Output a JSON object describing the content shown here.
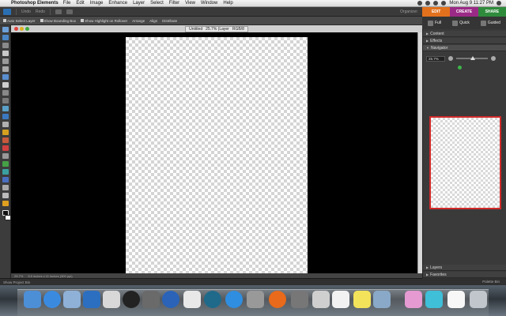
{
  "menubar": {
    "app_name": "Photoshop Elements",
    "items": [
      "File",
      "Edit",
      "Image",
      "Enhance",
      "Layer",
      "Select",
      "Filter",
      "View",
      "Window",
      "Help"
    ],
    "clock": "Mon Aug 9  11:27 PM"
  },
  "topbar": {
    "undo": "Undo",
    "redo": "Redo",
    "organizer": "Organizer"
  },
  "modes": {
    "edit": "EDIT",
    "create": "CREATE",
    "share": "SHARE"
  },
  "edit_tabs": {
    "full": "Full",
    "quick": "Quick",
    "guided": "Guided"
  },
  "options": {
    "auto_select": "Auto Select Layer",
    "bounding_box": "Show Bounding Box",
    "highlight": "Show Highlight on Rollover",
    "arrange": "Arrange",
    "align": "Align",
    "distribute": "Distribute"
  },
  "document": {
    "name": "Untitled",
    "zoom_info": "25.7% (Layer",
    "mode": "RGB/8"
  },
  "status": {
    "zoom": "25.7%",
    "info": "8.5 inches x 11 inches (300 ppi)"
  },
  "bins": {
    "project": "Show Project Bin",
    "palette": "Palette Bin"
  },
  "panels": {
    "content": "Content",
    "effects": "Effects",
    "navigator": "Navigator",
    "layers": "Layers",
    "favorites": "Favorites",
    "zoom_value": "25.7%"
  },
  "colors": {
    "edit": "#e2711d",
    "create": "#9b2a86",
    "share": "#2f8b3c",
    "thumb_border": "#d12a2a"
  },
  "dock_icons": [
    "finder-icon",
    "safari-icon",
    "preview-icon",
    "iphoto-icon",
    "printer-icon",
    "dashboard-icon",
    "photo-booth-icon",
    "google-earth-icon",
    "text-edit-icon",
    "time-machine-icon",
    "app-store-icon",
    "camera-icon",
    "firefox-icon",
    "system-prefs-icon",
    "photoshop-icon",
    "ical-icon",
    "stickies-icon",
    "iphoto-library-icon",
    "folder-icon",
    "bird-icon",
    "document-icon",
    "trash-icon"
  ]
}
